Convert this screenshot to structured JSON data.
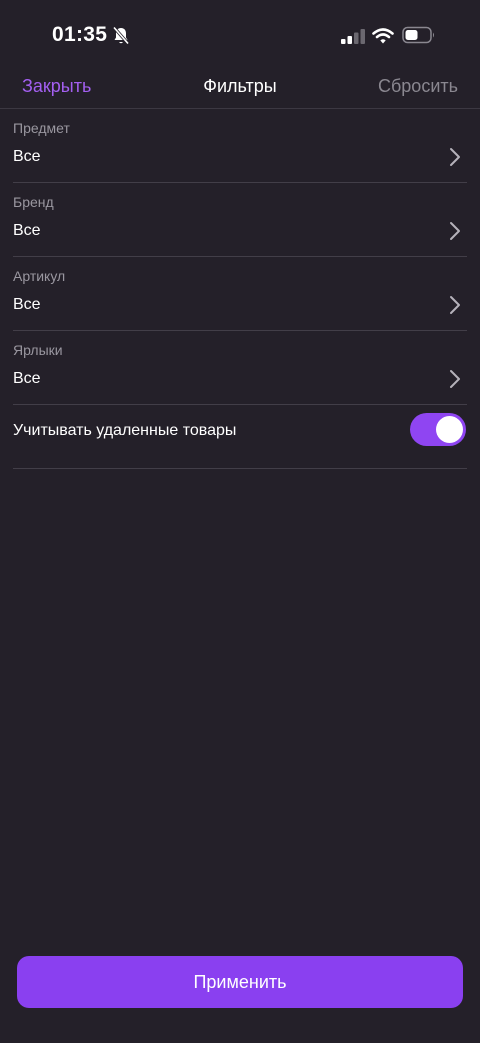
{
  "status_bar": {
    "time": "01:35"
  },
  "icons": {
    "bell": "bell-slash-icon",
    "signal": "cellular-signal-icon",
    "wifi": "wifi-icon",
    "battery": "battery-icon",
    "chevron": "chevron-right-icon"
  },
  "nav": {
    "close_label": "Закрыть",
    "title": "Фильтры",
    "reset_label": "Сбросить"
  },
  "filters": [
    {
      "label": "Предмет",
      "value": "Все"
    },
    {
      "label": "Бренд",
      "value": "Все"
    },
    {
      "label": "Артикул",
      "value": "Все"
    },
    {
      "label": "Ярлыки",
      "value": "Все"
    }
  ],
  "toggle": {
    "label": "Учитывать удаленные товары",
    "enabled": true
  },
  "apply_label": "Применить",
  "colors": {
    "background": "#242029",
    "accent": "#8a40f0",
    "close_link": "#a35ff0"
  }
}
